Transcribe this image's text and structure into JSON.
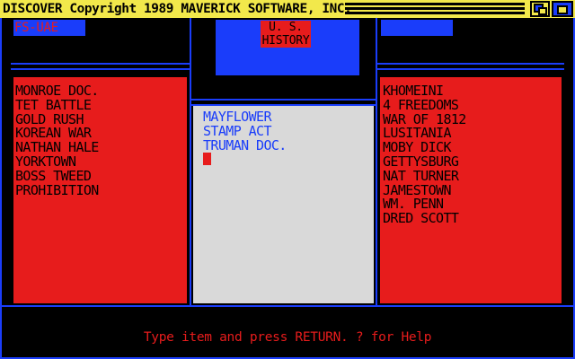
{
  "window": {
    "title": "DISCOVER Copyright 1989 MAVERICK SOFTWARE, INC.",
    "screen_label": "FS-UAE"
  },
  "header": {
    "line1": "U. S.",
    "line2": "HISTORY"
  },
  "left_list": {
    "items": [
      "MONROE DOC.",
      "TET BATTLE",
      "GOLD RUSH",
      "KOREAN WAR",
      "NATHAN HALE",
      "YORKTOWN",
      "BOSS TWEED",
      "PROHIBITION"
    ]
  },
  "middle_list": {
    "items": [
      "MAYFLOWER",
      "STAMP ACT",
      "TRUMAN DOC."
    ]
  },
  "right_list": {
    "items": [
      "KHOMEINI",
      "4 FREEDOMS",
      "WAR OF 1812",
      "LUSITANIA",
      "MOBY DICK",
      "GETTYSBURG",
      "NAT TURNER",
      "JAMESTOWN",
      "WM. PENN",
      "DRED SCOTT"
    ]
  },
  "status": {
    "prompt": "Type item and press RETURN. ? for Help"
  },
  "colors": {
    "title_bar": "#f2e84b",
    "blue": "#1a3dfa",
    "red": "#e71c1c",
    "grey": "#d9d9d9",
    "background": "#000000"
  }
}
